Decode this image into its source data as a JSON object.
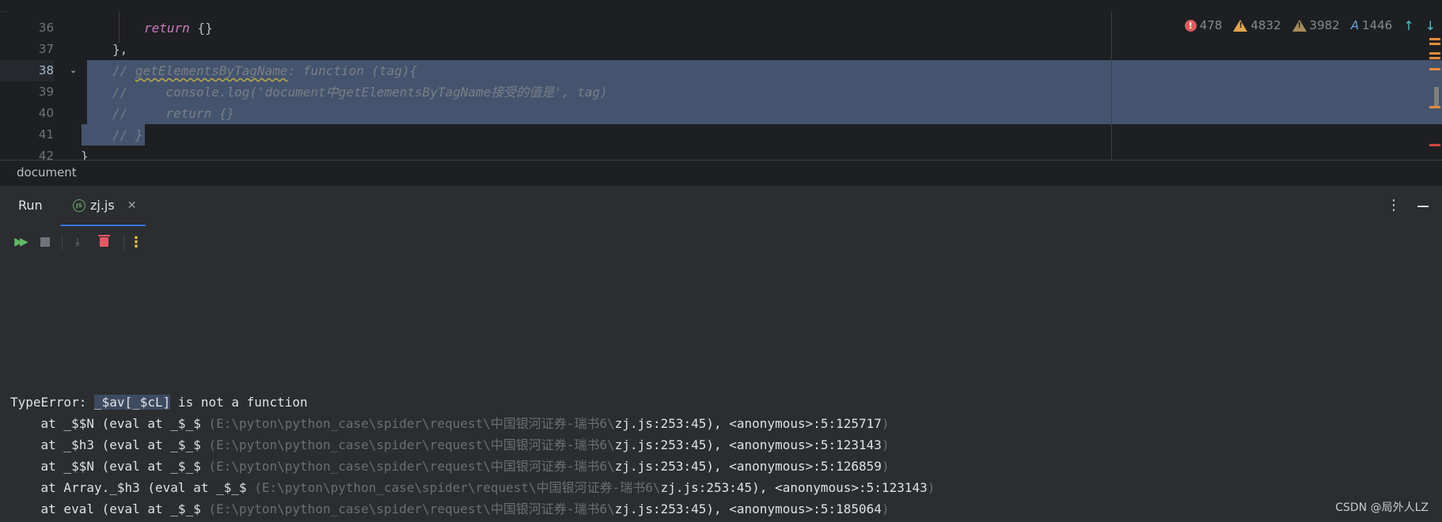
{
  "editor": {
    "lines": [
      {
        "num": "36",
        "active": false
      },
      {
        "num": "37",
        "active": false
      },
      {
        "num": "38",
        "active": true
      },
      {
        "num": "39",
        "active": false
      },
      {
        "num": "40",
        "active": false
      },
      {
        "num": "41",
        "active": false
      },
      {
        "num": "42",
        "active": false
      }
    ],
    "code": {
      "l36_kw": "return",
      "l36_rest": " {}",
      "l37": "},",
      "l38_a": "// ",
      "l38_b": "getElementsByTagName",
      "l38_c": ": function (tag){",
      "l39": "//     console.log('document中getElementsByTagName接受的值是', tag)",
      "l40": "//     return {}",
      "l41": "// }",
      "l42": "}"
    },
    "inspections": {
      "errors": "478",
      "warnings": "4832",
      "weak_warnings": "3982",
      "typos": "1446"
    }
  },
  "breadcrumb": "document",
  "run_panel": {
    "title": "Run",
    "tab_label": "zj.js",
    "tab_icon": "JS"
  },
  "console": {
    "error_prefix": "TypeError: ",
    "error_highlight": "_$av[_$cL]",
    "error_suffix": " is not a function",
    "frames": [
      {
        "prefix": "    at _$$N (eval at _$_$ ",
        "path": "(E:\\pyton\\python_case\\spider\\request\\中国银河证券-瑞书6\\",
        "link": "zj.js:253:45",
        "suffix": "), <anonymous>:5:125717",
        "close": ")"
      },
      {
        "prefix": "    at _$h3 (eval at _$_$ ",
        "path": "(E:\\pyton\\python_case\\spider\\request\\中国银河证券-瑞书6\\",
        "link": "zj.js:253:45",
        "suffix": "), <anonymous>:5:123143",
        "close": ")"
      },
      {
        "prefix": "    at _$$N (eval at _$_$ ",
        "path": "(E:\\pyton\\python_case\\spider\\request\\中国银河证券-瑞书6\\",
        "link": "zj.js:253:45",
        "suffix": "), <anonymous>:5:126859",
        "close": ")"
      },
      {
        "prefix": "    at Array._$h3 (eval at _$_$ ",
        "path": "(E:\\pyton\\python_case\\spider\\request\\中国银河证券-瑞书6\\",
        "link": "zj.js:253:45",
        "suffix": "), <anonymous>:5:123143",
        "close": ")"
      },
      {
        "prefix": "    at eval (eval at _$_$ ",
        "path": "(E:\\pyton\\python_case\\spider\\request\\中国银河证券-瑞书6\\",
        "link": "zj.js:253:45",
        "suffix": "), <anonymous>:5:185064",
        "close": ")"
      }
    ]
  },
  "watermark": "CSDN @局外人LZ",
  "colors": {
    "editor_bg": "#1e1f22",
    "panel_bg": "#2b2d30",
    "selection": "#44546f",
    "accent": "#3574f0",
    "error_red": "#db5c5c",
    "warning_orange": "#e0a64f"
  }
}
